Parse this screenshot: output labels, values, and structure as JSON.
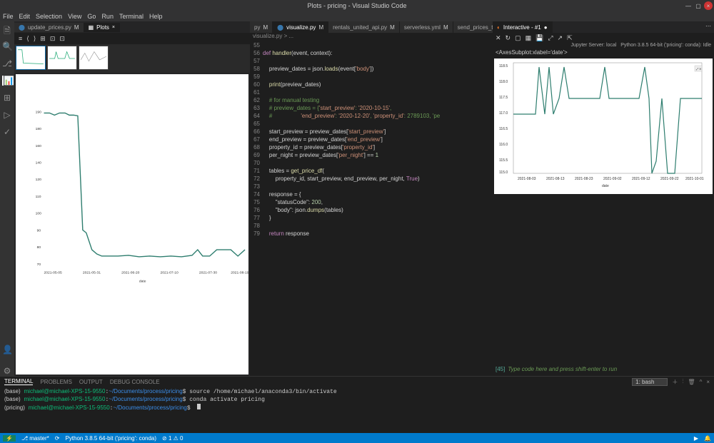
{
  "titlebar": {
    "title": "Plots - pricing - Visual Studio Code"
  },
  "menubar": [
    "File",
    "Edit",
    "Selection",
    "View",
    "Go",
    "Run",
    "Terminal",
    "Help"
  ],
  "left_tabs": {
    "a": "update_prices.py",
    "b": "Plots"
  },
  "plots": {
    "nav": [
      "≡",
      "⟨",
      "⟩",
      "⊞",
      "⊡",
      "⊡"
    ]
  },
  "editor2_tabs": [
    "py",
    "visualize.py",
    "rentals_united_api.py",
    "serverless.yml",
    "send_prices_to_hpdata.py"
  ],
  "breadcrumb": "visualize.py > ...",
  "right_tab": "Interactive - #1",
  "notebook": {
    "server": "Jupyter Server: local",
    "kernel": "Python 3.8.5 64-bit ('pricing': conda): Idle",
    "output_repr": "<AxesSubplot:xlabel='date'>",
    "input_prompt": "[45]",
    "input_placeholder": "Type code here and press shift-enter to run"
  },
  "code": {
    "start_line": 55,
    "lines": [
      "",
      "def handler(event, context):",
      "",
      "    preview_dates = json.loads(event['body'])",
      "",
      "    print(preview_dates)",
      "",
      "    # for manual testing",
      "    # preview_dates = {'start_preview': '2020-10-15',",
      "    #                  'end_preview': '2020-12-20', 'property_id': 2789103, 'pe",
      "",
      "    start_preview = preview_dates['start_preview']",
      "    end_preview = preview_dates['end_preview']",
      "    property_id = preview_dates['property_id']",
      "    per_night = preview_dates['per_night'] == 1",
      "",
      "    tables = get_price_df(",
      "        property_id, start_preview, end_preview, per_night, True)",
      "",
      "    response = {",
      "        \"statusCode\": 200,",
      "        \"body\": json.dumps(tables)",
      "    }",
      "",
      "    return response"
    ]
  },
  "chart_data": [
    {
      "type": "line",
      "x_ticks": [
        "2021-05-05",
        "2021-05-31",
        "2021-06-20",
        "2021-07-10",
        "2021-07-30",
        "2021-08-19"
      ],
      "y_ticks": [
        70,
        80,
        90,
        100,
        110,
        120,
        140,
        160,
        180,
        190
      ],
      "xlabel": "date",
      "ylabel": "",
      "values": [
        190,
        190,
        188,
        190,
        190,
        188,
        188,
        188,
        90,
        88,
        78,
        76,
        75,
        75,
        75,
        75,
        76,
        75,
        76,
        76,
        76,
        76,
        76,
        76,
        76,
        76,
        76,
        76,
        76,
        76,
        76,
        80,
        76,
        76,
        80,
        80,
        80,
        76,
        80
      ]
    },
    {
      "type": "line",
      "x_ticks": [
        "2021-08-03",
        "2021-08-13",
        "2021-08-23",
        "2021-09-02",
        "2021-09-12",
        "2021-09-22",
        "2021-10-01"
      ],
      "y_ticks": [
        115.0,
        115.5,
        116.0,
        116.5,
        117.0,
        117.5,
        118.0,
        118.5
      ],
      "xlabel": "date",
      "ylabel": "",
      "values": [
        117.0,
        117.0,
        117.0,
        117.0,
        118.5,
        117.0,
        118.5,
        117.0,
        117.5,
        118.5,
        117.5,
        117.5,
        117.5,
        117.5,
        117.5,
        117.5,
        117.5,
        118.5,
        117.5,
        117.5,
        117.5,
        117.5,
        118.5,
        117.5,
        115.0,
        115.5,
        117.5,
        115.0,
        115.0,
        117.5,
        117.5,
        117.5,
        117.5,
        117.5
      ]
    }
  ],
  "bottom_panel": {
    "tabs": [
      "TERMINAL",
      "PROBLEMS",
      "OUTPUT",
      "DEBUG CONSOLE"
    ],
    "shell": "1: bash",
    "lines": [
      {
        "env": "(base)",
        "user": "michael@michael-XPS-15-9550",
        "path": "~/Documents/process/pricing",
        "cmd": "source /home/michael/anaconda3/bin/activate"
      },
      {
        "env": "(base)",
        "user": "michael@michael-XPS-15-9550",
        "path": "~/Documents/process/pricing",
        "cmd": "conda activate pricing"
      },
      {
        "env": "(pricing)",
        "user": "michael@michael-XPS-15-9550",
        "path": "~/Documents/process/pricing",
        "cmd": ""
      }
    ]
  },
  "statusbar": {
    "branch": "master*",
    "python": "Python 3.8.5 64-bit ('pricing': conda)",
    "errors": "⊘ 1  ⚠ 0",
    "right": [
      "▶",
      ""
    ]
  }
}
